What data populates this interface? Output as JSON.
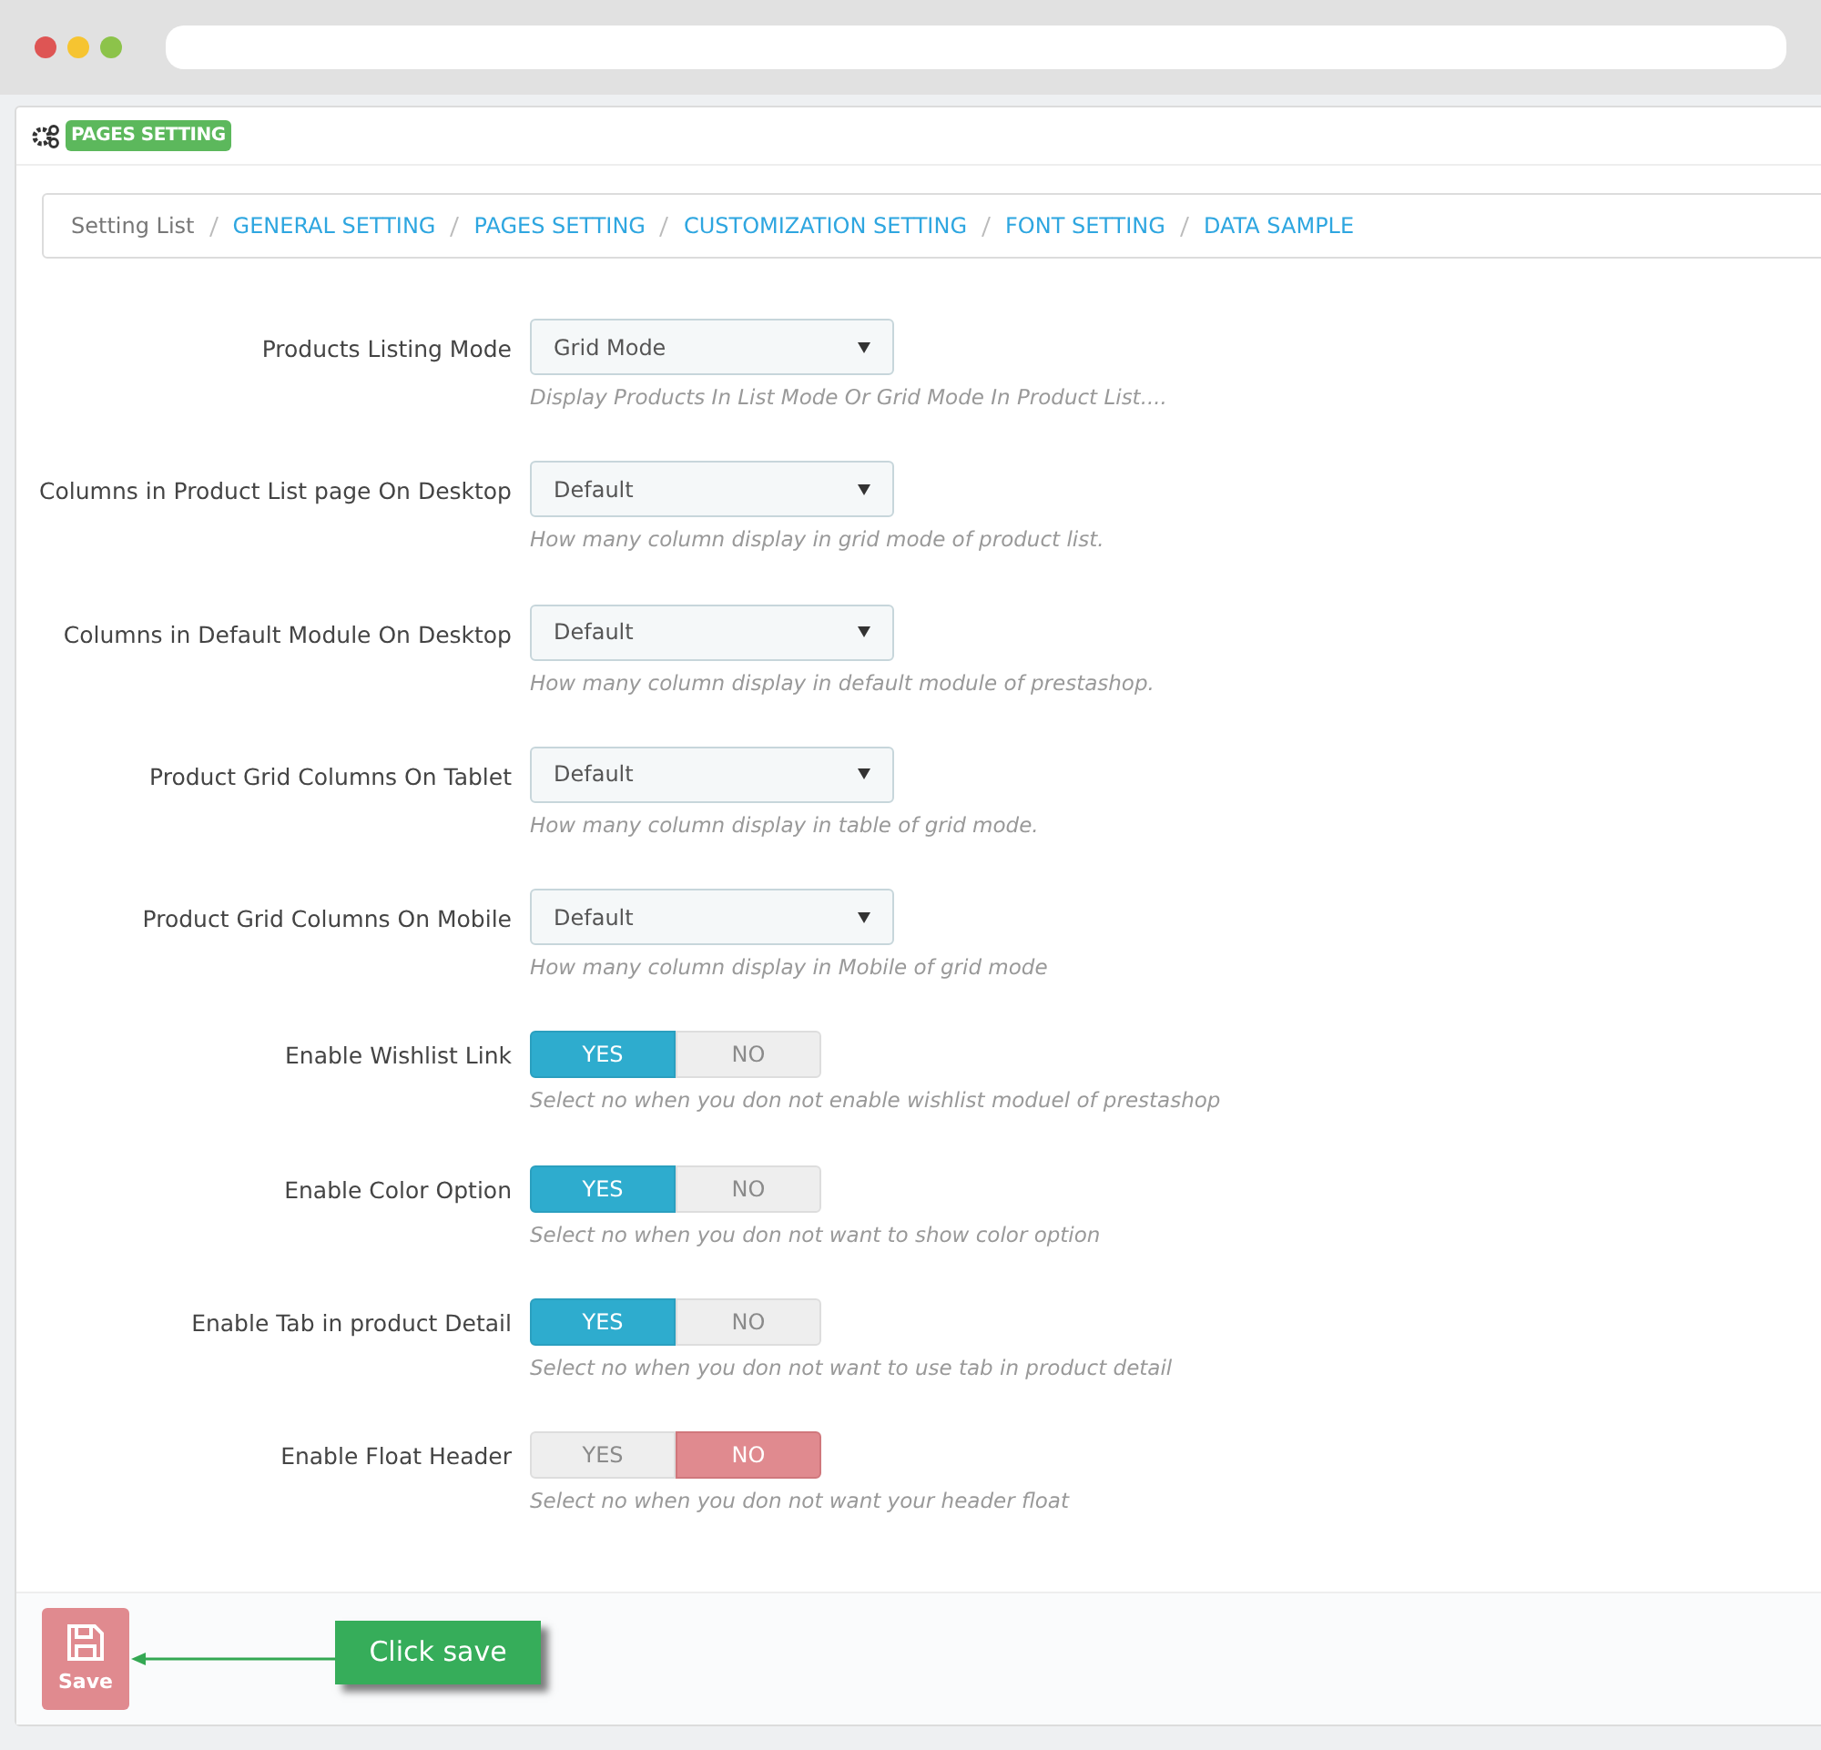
{
  "panel": {
    "badge": "PAGES SETTING"
  },
  "breadcrumb": [
    {
      "label": "Setting List",
      "kind": "text"
    },
    {
      "label": "GENERAL SETTING",
      "kind": "link"
    },
    {
      "label": "PAGES SETTING",
      "kind": "link"
    },
    {
      "label": "CUSTOMIZATION SETTING",
      "kind": "link"
    },
    {
      "label": "FONT SETTING",
      "kind": "link"
    },
    {
      "label": "DATA SAMPLE",
      "kind": "link"
    }
  ],
  "fields": [
    {
      "kind": "select",
      "label": "Products Listing Mode",
      "value": "Grid Mode",
      "help": "Display Products In List Mode Or Grid Mode In Product List...."
    },
    {
      "kind": "select",
      "label": "Columns in Product List page On Desktop",
      "value": "Default",
      "help": "How many column display in grid mode of product list."
    },
    {
      "kind": "select",
      "label": "Columns in Default Module On Desktop",
      "value": "Default",
      "help": "How many column display in default module of prestashop."
    },
    {
      "kind": "select",
      "label": "Product Grid Columns On Tablet",
      "value": "Default",
      "help": "How many column display in table of grid mode."
    },
    {
      "kind": "select",
      "label": "Product Grid Columns On Mobile",
      "value": "Default",
      "help": "How many column display in Mobile of grid mode"
    },
    {
      "kind": "toggle",
      "label": "Enable Wishlist Link",
      "options": [
        {
          "label": "YES",
          "selected": true
        },
        {
          "label": "NO",
          "selected": false
        }
      ],
      "help": "Select no when you don not enable wishlist moduel of prestashop"
    },
    {
      "kind": "toggle",
      "label": "Enable Color Option",
      "options": [
        {
          "label": "YES",
          "selected": true
        },
        {
          "label": "NO",
          "selected": false
        }
      ],
      "help": "Select no when you don not want to show color option"
    },
    {
      "kind": "toggle",
      "label": "Enable Tab in product Detail",
      "options": [
        {
          "label": "YES",
          "selected": true
        },
        {
          "label": "NO",
          "selected": false
        }
      ],
      "help": "Select no when you don not want to use tab in product detail"
    },
    {
      "kind": "toggle",
      "label": "Enable Float Header",
      "options": [
        {
          "label": "YES",
          "selected": false
        },
        {
          "label": "NO",
          "selected": true
        }
      ],
      "help": "Select no when you don not want your header float"
    }
  ],
  "footer": {
    "save": "Save",
    "callout": "Click save"
  }
}
